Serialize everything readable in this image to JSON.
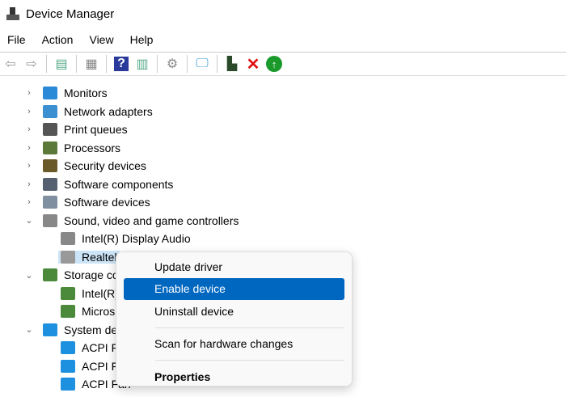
{
  "window": {
    "title": "Device Manager"
  },
  "menubar": [
    "File",
    "Action",
    "View",
    "Help"
  ],
  "toolbar": [
    "back-icon",
    "forward-icon",
    "show-hide-console-tree-icon",
    "properties-icon",
    "help-icon",
    "action-pane-icon",
    "update-driver-icon",
    "scan-hardware-icon",
    "enable-device-icon",
    "uninstall-icon",
    "download-icon"
  ],
  "tree": [
    {
      "label": "Monitors",
      "level": 0,
      "expanded": false,
      "color": "#2a8ad8"
    },
    {
      "label": "Network adapters",
      "level": 0,
      "expanded": false,
      "color": "#3a90d0"
    },
    {
      "label": "Print queues",
      "level": 0,
      "expanded": false,
      "color": "#555555"
    },
    {
      "label": "Processors",
      "level": 0,
      "expanded": false,
      "color": "#5b7a3a"
    },
    {
      "label": "Security devices",
      "level": 0,
      "expanded": false,
      "color": "#6a5a2a"
    },
    {
      "label": "Software components",
      "level": 0,
      "expanded": false,
      "color": "#556070"
    },
    {
      "label": "Software devices",
      "level": 0,
      "expanded": false,
      "color": "#8090a0"
    },
    {
      "label": "Sound, video and game controllers",
      "level": 0,
      "expanded": true,
      "color": "#888888"
    },
    {
      "label": "Intel(R) Display Audio",
      "level": 1,
      "color": "#888888"
    },
    {
      "label": "Realtel",
      "level": 1,
      "selected": true,
      "color": "#999999"
    },
    {
      "label": "Storage co",
      "level": 0,
      "expanded": true,
      "color": "#4a8a3a"
    },
    {
      "label": "Intel(R)",
      "level": 1,
      "color": "#4a8a3a"
    },
    {
      "label": "Micros",
      "level": 1,
      "color": "#4a8a3a"
    },
    {
      "label": "System de",
      "level": 0,
      "expanded": true,
      "color": "#1e90e0"
    },
    {
      "label": "ACPI Fa",
      "level": 1,
      "color": "#1e90e0"
    },
    {
      "label": "ACPI Fa",
      "level": 1,
      "color": "#1e90e0"
    },
    {
      "label": "ACPI Fan",
      "level": 1,
      "color": "#1e90e0"
    }
  ],
  "context_menu": {
    "items": [
      "Update driver",
      "Enable device",
      "Uninstall device",
      "Scan for hardware changes",
      "Properties"
    ],
    "highlight": "#0067c0"
  }
}
